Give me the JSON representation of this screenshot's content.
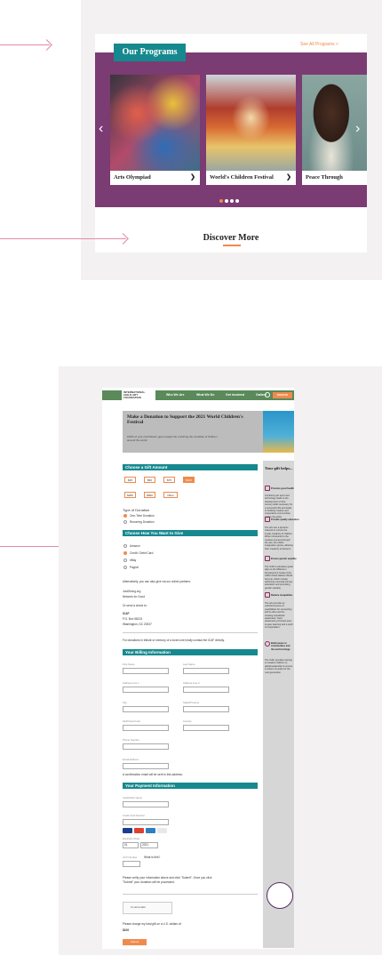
{
  "top": {
    "tab_label": "Our Programs",
    "see_all": "See All Programs  >",
    "cards": [
      {
        "caption": "Arts Olympiad"
      },
      {
        "caption": "World's Children Festival"
      },
      {
        "caption": "Peace Through"
      }
    ],
    "prev_arrow": "‹",
    "next_arrow": "›",
    "discover": "Discover More"
  },
  "bottom": {
    "nav": {
      "logo": "INTERNATIONAL CHILD ART FOUNDATION",
      "items": [
        "Who We Are",
        "What We Do",
        "Get Involved",
        "Gallery"
      ],
      "donate": "DONATE"
    },
    "hero": {
      "title": "Make a Donation to Support the 2021 World Children's Festival",
      "subtitle": "100% of your contribution goes toward the enriching the creativity of children around the world."
    },
    "sections": {
      "gift": "Choose a Gift Amount",
      "how": "Choose How You Want to Give",
      "billing": "Your Billing Information",
      "payment": "Your Payment Information"
    },
    "amounts_row1": [
      "$25",
      "$50",
      "$75",
      "$100"
    ],
    "amounts_row2": [
      "$250",
      "$500",
      "Other"
    ],
    "type_label": "Type of Donation",
    "type_options": [
      "One-Time Donation",
      "Recurring Donation"
    ],
    "give_options": [
      "Amazon",
      "Credit / Debit Card",
      "eBay",
      "Paypal"
    ],
    "give_note": "Alternatively, you can also give via our online partners:",
    "links": [
      "JustGiving.org",
      "Network for Good"
    ],
    "check_note": "Or send a check to:",
    "address": [
      "ICAF",
      "P.O. Box 58133",
      "Washington, DC 20037"
    ],
    "tribute": "For donations in tribute or memory of a loved one kindly contact the ICAF directly.",
    "billing_fields": [
      "First Name",
      "Last Name",
      "Address Line 1",
      "Address Line 2",
      "City",
      "State/Province",
      "Zip/Postal Code",
      "Country",
      "Phone Number",
      "Email Address"
    ],
    "email_note": "A confirmation email will be sent to this address.",
    "payment_fields": [
      "Cardholder Name",
      "Credit Card Number",
      "Expiration Date",
      "CVV Number"
    ],
    "cvv_help": "What is this?",
    "exp_month": "01",
    "exp_year": "2021",
    "verify_note": "Please verify your information above and click \"Submit\". Once you click \"Submit\" your donation will be processed.",
    "recaptcha": "I'm not a robot",
    "cover_fee": "Please charge my total gift on a U.S. dollars of:",
    "total": "$100",
    "submit": "Submit",
    "sidebar": {
      "title": "Your gift helps...",
      "items": [
        {
          "head": "Promote good health",
          "text": "Combining art sport and technology leads to the development of 21st century skills necessary for a successful life and leads to building creative and cooperative communities across the globe."
        },
        {
          "head": "Provide quality education",
          "text": "The arts are a dynamic channel to nurture the innate creativity of children. When introduced to the creative process through the arts, the child's imagination grows, allowing their creativity to blossom."
        },
        {
          "head": "Ensure gender equality",
          "text": "The ICAF's education goals align to the Millenium Development Goals of the 1990 United Nations World Summit, which include achieving universal primary education and promoting gender equality."
        },
        {
          "head": "Reduce inequalities",
          "text": "The arts provide an unlimited source of possibilities for connecting self to other and for creating empathetic awareness. Such awareness promotes peer-to-peer learning and a spirit of cooperation."
        },
        {
          "head": "Build peace in communities and the world at large",
          "text": "The ICAF provides training to creative children on global leadership to ensure a culture of peace for the next generation."
        }
      ]
    }
  }
}
